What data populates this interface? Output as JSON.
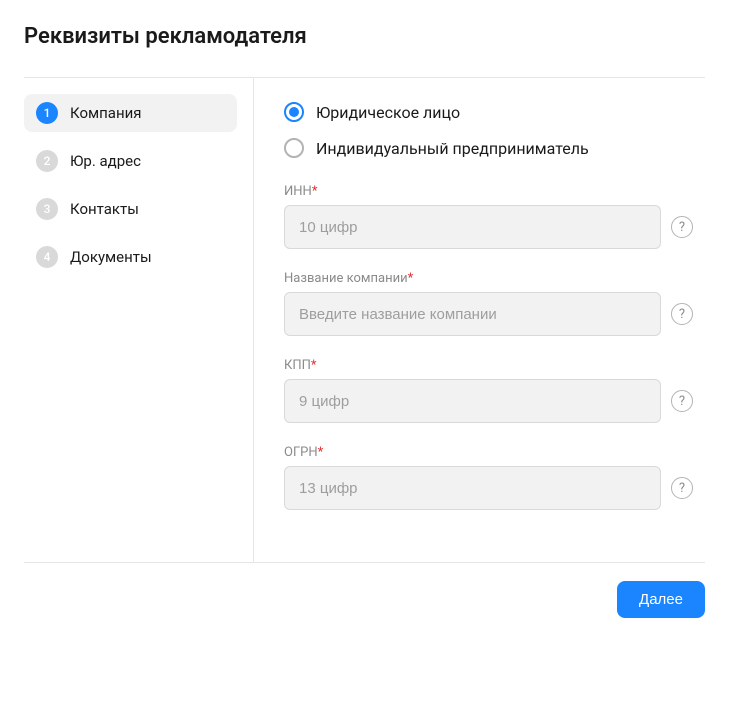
{
  "page": {
    "title": "Реквизиты рекламодателя"
  },
  "sidebar": {
    "steps": [
      {
        "num": "1",
        "label": "Компания",
        "active": true
      },
      {
        "num": "2",
        "label": "Юр. адрес",
        "active": false
      },
      {
        "num": "3",
        "label": "Контакты",
        "active": false
      },
      {
        "num": "4",
        "label": "Документы",
        "active": false
      }
    ]
  },
  "form": {
    "entity_type": {
      "options": [
        {
          "label": "Юридическое лицо",
          "selected": true
        },
        {
          "label": "Индивидуальный предприниматель",
          "selected": false
        }
      ]
    },
    "fields": {
      "inn": {
        "label": "ИНН",
        "required": true,
        "placeholder": "10 цифр",
        "value": ""
      },
      "company_name": {
        "label": "Название компании",
        "required": true,
        "placeholder": "Введите название компании",
        "value": ""
      },
      "kpp": {
        "label": "КПП",
        "required": true,
        "placeholder": "9 цифр",
        "value": ""
      },
      "ogrn": {
        "label": "ОГРН",
        "required": true,
        "placeholder": "13 цифр",
        "value": ""
      }
    }
  },
  "footer": {
    "next_label": "Далее"
  },
  "glyphs": {
    "help": "?",
    "required": "*"
  }
}
